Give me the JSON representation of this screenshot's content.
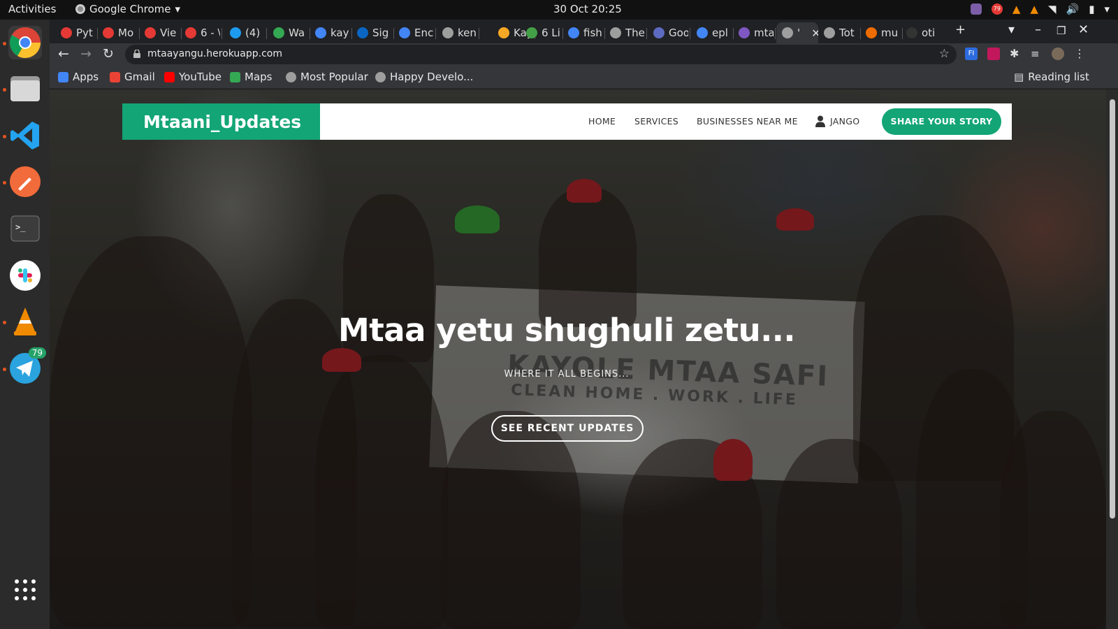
{
  "desktop": {
    "activities": "Activities",
    "app_menu": "Google Chrome",
    "clock": "30 Oct  20:25",
    "tray_badge": "79"
  },
  "dock": {
    "items": [
      {
        "name": "Google Chrome",
        "icon": "chrome-icon"
      },
      {
        "name": "Files",
        "icon": "files-icon"
      },
      {
        "name": "Visual Studio Code",
        "icon": "vscode-icon"
      },
      {
        "name": "Postman",
        "icon": "postman-icon"
      },
      {
        "name": "Terminal",
        "icon": "terminal-icon"
      },
      {
        "name": "Slack",
        "icon": "slack-icon"
      },
      {
        "name": "VLC",
        "icon": "vlc-icon"
      },
      {
        "name": "Telegram",
        "icon": "telegram-icon",
        "badge": "79"
      },
      {
        "name": "Show Applications",
        "icon": "app-grid-icon"
      }
    ]
  },
  "tabs": [
    {
      "label": "Pyt",
      "color": "#e53935"
    },
    {
      "label": "Mo",
      "color": "#e53935"
    },
    {
      "label": "Vie",
      "color": "#e53935"
    },
    {
      "label": "6 - \\",
      "color": "#e53935"
    },
    {
      "label": "(4)",
      "color": "#1d9bf0"
    },
    {
      "label": "Wa",
      "color": "#34a853"
    },
    {
      "label": "kay",
      "color": "#4285f4"
    },
    {
      "label": "Sig",
      "color": "#0a66c2"
    },
    {
      "label": "Enc",
      "color": "#4285f4"
    },
    {
      "label": "ken",
      "color": "#9e9e9e"
    },
    {
      "label": "Kay",
      "color": "#f9a825"
    },
    {
      "label": "6 Li",
      "color": "#43a047"
    },
    {
      "label": "fish",
      "color": "#4285f4"
    },
    {
      "label": "The",
      "color": "#9e9e9e"
    },
    {
      "label": "Goo",
      "color": "#5c6bc0"
    },
    {
      "label": "epl",
      "color": "#4285f4"
    },
    {
      "label": "mta",
      "color": "#7e57c2"
    },
    {
      "label": "'",
      "color": "#9e9e9e",
      "active": true
    },
    {
      "label": "Tot",
      "color": "#9e9e9e"
    },
    {
      "label": "mu",
      "color": "#ef6c00"
    },
    {
      "label": "oti",
      "color": "#333333"
    }
  ],
  "toolbar": {
    "url": "mtaayangu.herokuapp.com",
    "new_tab": "+",
    "window_controls": [
      "▾",
      "–",
      "❐",
      "✕"
    ]
  },
  "bookmarks": [
    {
      "label": "Apps",
      "icon": "apps-grid-icon",
      "color": "#4285f4"
    },
    {
      "label": "Gmail",
      "icon": "gmail-icon",
      "color": "#ea4335"
    },
    {
      "label": "YouTube",
      "icon": "youtube-icon",
      "color": "#ff0000"
    },
    {
      "label": "Maps",
      "icon": "maps-icon",
      "color": "#34a853"
    },
    {
      "label": "Most Popular",
      "icon": "globe-icon",
      "color": "#9e9e9e"
    },
    {
      "label": "Happy Develo...",
      "icon": "globe-icon",
      "color": "#9e9e9e"
    }
  ],
  "reading_list": "Reading list",
  "site": {
    "brand": "Mtaani_Updates",
    "nav": [
      "HOME",
      "SERVICES",
      "BUSINESSES NEAR ME"
    ],
    "user": "JANGO",
    "share": "SHARE YOUR STORY",
    "accent": "#13a575",
    "hero_title": "Mtaa yetu shughuli zetu...",
    "hero_subtitle": "WHERE IT ALL BEGINS...",
    "hero_button": "SEE RECENT UPDATES",
    "photo_banner_title": "KAYOLE MTAA SAFI",
    "photo_banner_motto": "CLEAN HOME . WORK . LIFE"
  }
}
